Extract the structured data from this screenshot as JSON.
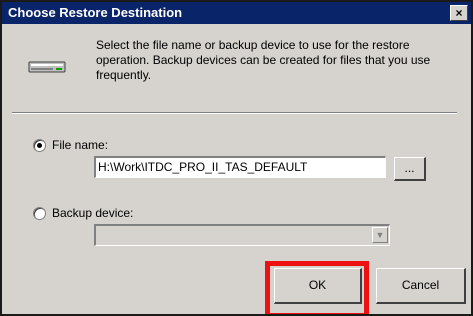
{
  "dialog": {
    "title": "Choose Restore Destination",
    "close_glyph": "×",
    "description": "Select the file name or backup device to use for the restore operation.  Backup devices can be created for files that you use frequently."
  },
  "file_name_option": {
    "label": "File name:",
    "selected": true,
    "value": "H:\\Work\\ITDC_PRO_II_TAS_DEFAULT",
    "browse_label": "..."
  },
  "backup_device_option": {
    "label": "Backup device:",
    "selected": false,
    "value": "",
    "disabled": true
  },
  "buttons": {
    "ok_label": "OK",
    "cancel_label": "Cancel"
  },
  "icons": {
    "device": "drive-icon",
    "dropdown": "chevron-down-icon",
    "close": "close-icon"
  },
  "colors": {
    "titlebar": "#0a246a",
    "dialog_bg": "#d6d3ce",
    "highlight": "#ee1111"
  }
}
